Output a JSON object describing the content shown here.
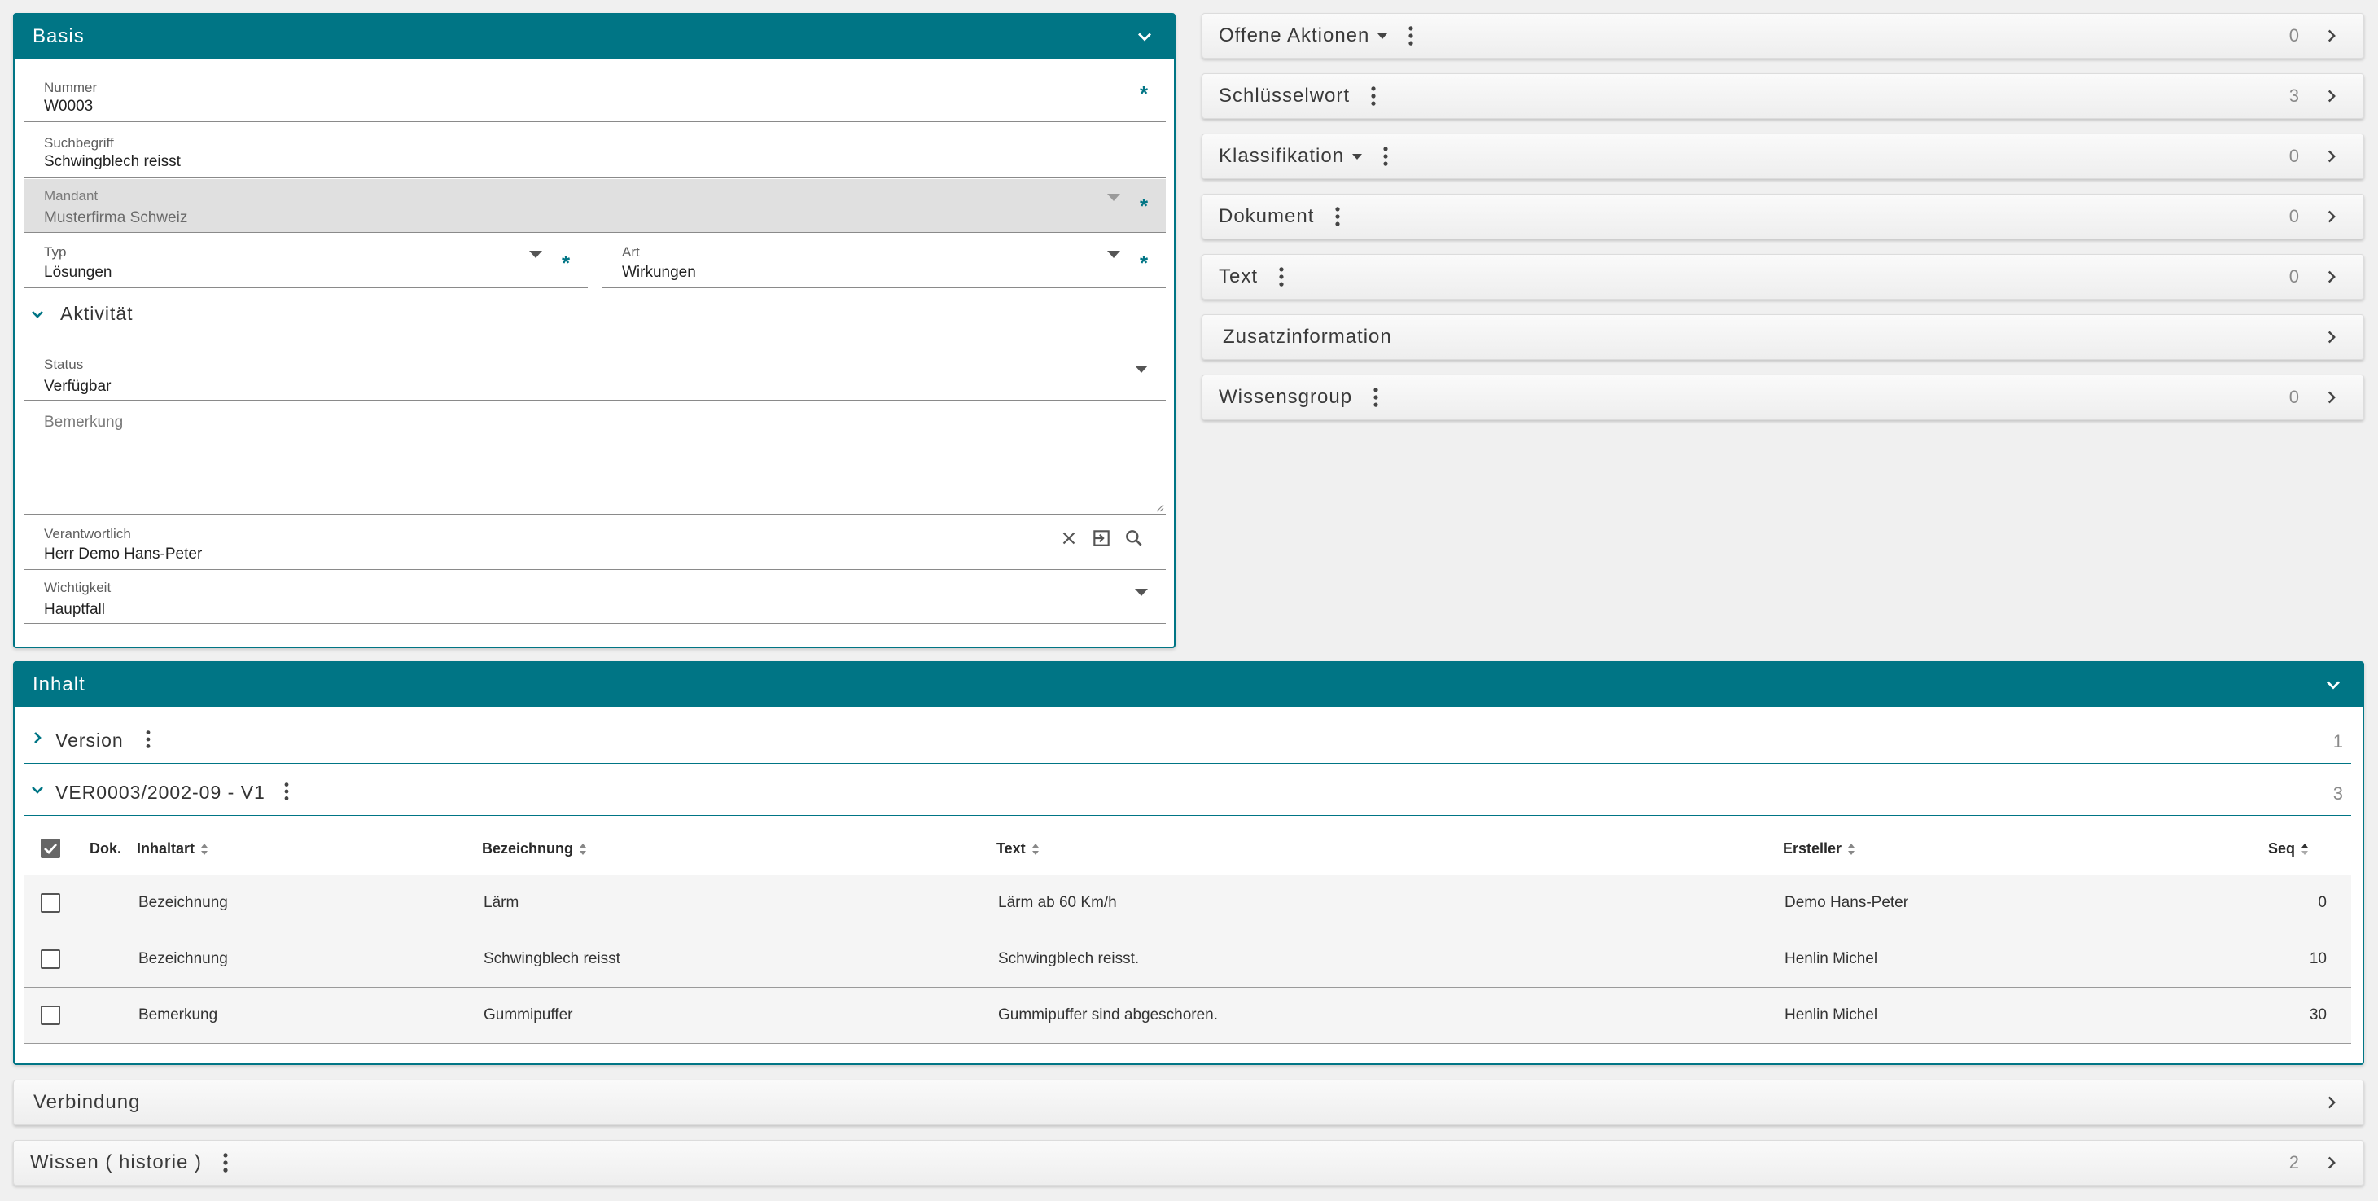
{
  "basis": {
    "title": "Basis",
    "nummer": {
      "label": "Nummer",
      "value": "W0003"
    },
    "suchbegriff": {
      "label": "Suchbegriff",
      "value": "Schwingblech reisst"
    },
    "mandant": {
      "label": "Mandant",
      "value": "Musterfirma Schweiz"
    },
    "typ": {
      "label": "Typ",
      "value": "Lösungen"
    },
    "art": {
      "label": "Art",
      "value": "Wirkungen"
    },
    "aktivitaet": {
      "label": "Aktivität"
    },
    "status": {
      "label": "Status",
      "value": "Verfügbar"
    },
    "bemerkung": {
      "placeholder": "Bemerkung"
    },
    "verantwortlich": {
      "label": "Verantwortlich",
      "value": "Herr Demo Hans-Peter"
    },
    "wichtigkeit": {
      "label": "Wichtigkeit",
      "value": "Hauptfall"
    },
    "required_mark": "*"
  },
  "side_sections": [
    {
      "label": "Offene Aktionen",
      "count": "0"
    },
    {
      "label": "Schlüsselwort",
      "count": "3"
    },
    {
      "label": "Klassifikation",
      "count": "0"
    },
    {
      "label": "Dokument",
      "count": "0"
    },
    {
      "label": "Text",
      "count": "0"
    },
    {
      "label": "Zusatzinformation",
      "count": ""
    },
    {
      "label": "Wissensgroup",
      "count": "0"
    }
  ],
  "inhalt": {
    "title": "Inhalt",
    "version": {
      "label": "Version",
      "count": "1"
    },
    "ver_group": {
      "label": "VER0003/2002-09 - V1",
      "count": "3"
    },
    "columns": {
      "dok": "Dok.",
      "inhaltart": "Inhaltart",
      "bezeichnung": "Bezeichnung",
      "text": "Text",
      "ersteller": "Ersteller",
      "seq": "Seq"
    },
    "rows": [
      {
        "inhaltart": "Bezeichnung",
        "bezeichnung": "Lärm",
        "text": "Lärm ab 60 Km/h",
        "ersteller": "Demo Hans-Peter",
        "seq": "0"
      },
      {
        "inhaltart": "Bezeichnung",
        "bezeichnung": "Schwingblech reisst",
        "text": "Schwingblech reisst.",
        "ersteller": "Henlin Michel",
        "seq": "10"
      },
      {
        "inhaltart": "Bemerkung",
        "bezeichnung": "Gummipuffer",
        "text": "Gummipuffer sind abgeschoren.",
        "ersteller": "Henlin Michel",
        "seq": "30"
      }
    ]
  },
  "verbindung": {
    "label": "Verbindung"
  },
  "wissen_historie": {
    "label": "Wissen ( historie )",
    "count": "2"
  },
  "colors": {
    "accent": "#007585",
    "background": "#f0f0f0",
    "disabled_field": "#e0e0e0"
  }
}
